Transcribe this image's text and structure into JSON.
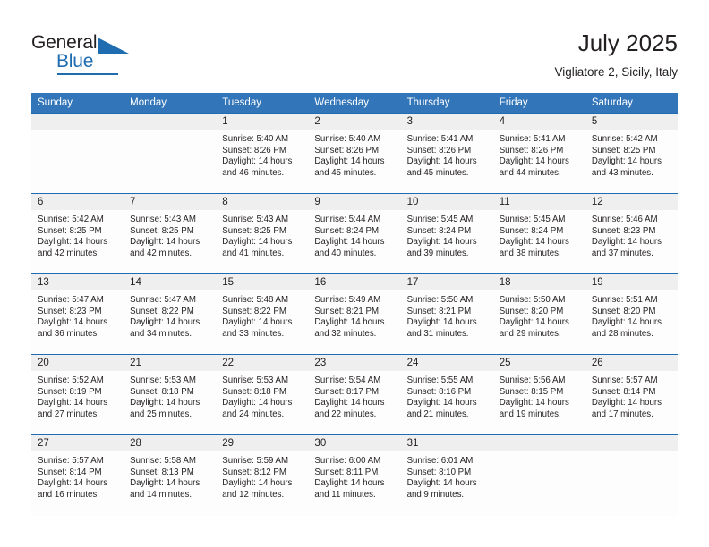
{
  "brand": {
    "name_part1": "General",
    "name_part2": "Blue",
    "logo_icon": "triangle-flag-icon",
    "accent_color": "#1f6cb0"
  },
  "header": {
    "title": "July 2025",
    "subtitle": "Vigliatore 2, Sicily, Italy"
  },
  "calendar": {
    "header_bg": "#3275b9",
    "row_rule_color": "#1f6cb0",
    "daynum_band_bg": "#efefef",
    "weekdays": [
      "Sunday",
      "Monday",
      "Tuesday",
      "Wednesday",
      "Thursday",
      "Friday",
      "Saturday"
    ],
    "weeks": [
      [
        {
          "day": "",
          "sunrise": "",
          "sunset": "",
          "daylight1": "",
          "daylight2": "",
          "empty": true
        },
        {
          "day": "",
          "sunrise": "",
          "sunset": "",
          "daylight1": "",
          "daylight2": "",
          "empty": true
        },
        {
          "day": "1",
          "sunrise": "Sunrise: 5:40 AM",
          "sunset": "Sunset: 8:26 PM",
          "daylight1": "Daylight: 14 hours",
          "daylight2": "and 46 minutes."
        },
        {
          "day": "2",
          "sunrise": "Sunrise: 5:40 AM",
          "sunset": "Sunset: 8:26 PM",
          "daylight1": "Daylight: 14 hours",
          "daylight2": "and 45 minutes."
        },
        {
          "day": "3",
          "sunrise": "Sunrise: 5:41 AM",
          "sunset": "Sunset: 8:26 PM",
          "daylight1": "Daylight: 14 hours",
          "daylight2": "and 45 minutes."
        },
        {
          "day": "4",
          "sunrise": "Sunrise: 5:41 AM",
          "sunset": "Sunset: 8:26 PM",
          "daylight1": "Daylight: 14 hours",
          "daylight2": "and 44 minutes."
        },
        {
          "day": "5",
          "sunrise": "Sunrise: 5:42 AM",
          "sunset": "Sunset: 8:25 PM",
          "daylight1": "Daylight: 14 hours",
          "daylight2": "and 43 minutes."
        }
      ],
      [
        {
          "day": "6",
          "sunrise": "Sunrise: 5:42 AM",
          "sunset": "Sunset: 8:25 PM",
          "daylight1": "Daylight: 14 hours",
          "daylight2": "and 42 minutes."
        },
        {
          "day": "7",
          "sunrise": "Sunrise: 5:43 AM",
          "sunset": "Sunset: 8:25 PM",
          "daylight1": "Daylight: 14 hours",
          "daylight2": "and 42 minutes."
        },
        {
          "day": "8",
          "sunrise": "Sunrise: 5:43 AM",
          "sunset": "Sunset: 8:25 PM",
          "daylight1": "Daylight: 14 hours",
          "daylight2": "and 41 minutes."
        },
        {
          "day": "9",
          "sunrise": "Sunrise: 5:44 AM",
          "sunset": "Sunset: 8:24 PM",
          "daylight1": "Daylight: 14 hours",
          "daylight2": "and 40 minutes."
        },
        {
          "day": "10",
          "sunrise": "Sunrise: 5:45 AM",
          "sunset": "Sunset: 8:24 PM",
          "daylight1": "Daylight: 14 hours",
          "daylight2": "and 39 minutes."
        },
        {
          "day": "11",
          "sunrise": "Sunrise: 5:45 AM",
          "sunset": "Sunset: 8:24 PM",
          "daylight1": "Daylight: 14 hours",
          "daylight2": "and 38 minutes."
        },
        {
          "day": "12",
          "sunrise": "Sunrise: 5:46 AM",
          "sunset": "Sunset: 8:23 PM",
          "daylight1": "Daylight: 14 hours",
          "daylight2": "and 37 minutes."
        }
      ],
      [
        {
          "day": "13",
          "sunrise": "Sunrise: 5:47 AM",
          "sunset": "Sunset: 8:23 PM",
          "daylight1": "Daylight: 14 hours",
          "daylight2": "and 36 minutes."
        },
        {
          "day": "14",
          "sunrise": "Sunrise: 5:47 AM",
          "sunset": "Sunset: 8:22 PM",
          "daylight1": "Daylight: 14 hours",
          "daylight2": "and 34 minutes."
        },
        {
          "day": "15",
          "sunrise": "Sunrise: 5:48 AM",
          "sunset": "Sunset: 8:22 PM",
          "daylight1": "Daylight: 14 hours",
          "daylight2": "and 33 minutes."
        },
        {
          "day": "16",
          "sunrise": "Sunrise: 5:49 AM",
          "sunset": "Sunset: 8:21 PM",
          "daylight1": "Daylight: 14 hours",
          "daylight2": "and 32 minutes."
        },
        {
          "day": "17",
          "sunrise": "Sunrise: 5:50 AM",
          "sunset": "Sunset: 8:21 PM",
          "daylight1": "Daylight: 14 hours",
          "daylight2": "and 31 minutes."
        },
        {
          "day": "18",
          "sunrise": "Sunrise: 5:50 AM",
          "sunset": "Sunset: 8:20 PM",
          "daylight1": "Daylight: 14 hours",
          "daylight2": "and 29 minutes."
        },
        {
          "day": "19",
          "sunrise": "Sunrise: 5:51 AM",
          "sunset": "Sunset: 8:20 PM",
          "daylight1": "Daylight: 14 hours",
          "daylight2": "and 28 minutes."
        }
      ],
      [
        {
          "day": "20",
          "sunrise": "Sunrise: 5:52 AM",
          "sunset": "Sunset: 8:19 PM",
          "daylight1": "Daylight: 14 hours",
          "daylight2": "and 27 minutes."
        },
        {
          "day": "21",
          "sunrise": "Sunrise: 5:53 AM",
          "sunset": "Sunset: 8:18 PM",
          "daylight1": "Daylight: 14 hours",
          "daylight2": "and 25 minutes."
        },
        {
          "day": "22",
          "sunrise": "Sunrise: 5:53 AM",
          "sunset": "Sunset: 8:18 PM",
          "daylight1": "Daylight: 14 hours",
          "daylight2": "and 24 minutes."
        },
        {
          "day": "23",
          "sunrise": "Sunrise: 5:54 AM",
          "sunset": "Sunset: 8:17 PM",
          "daylight1": "Daylight: 14 hours",
          "daylight2": "and 22 minutes."
        },
        {
          "day": "24",
          "sunrise": "Sunrise: 5:55 AM",
          "sunset": "Sunset: 8:16 PM",
          "daylight1": "Daylight: 14 hours",
          "daylight2": "and 21 minutes."
        },
        {
          "day": "25",
          "sunrise": "Sunrise: 5:56 AM",
          "sunset": "Sunset: 8:15 PM",
          "daylight1": "Daylight: 14 hours",
          "daylight2": "and 19 minutes."
        },
        {
          "day": "26",
          "sunrise": "Sunrise: 5:57 AM",
          "sunset": "Sunset: 8:14 PM",
          "daylight1": "Daylight: 14 hours",
          "daylight2": "and 17 minutes."
        }
      ],
      [
        {
          "day": "27",
          "sunrise": "Sunrise: 5:57 AM",
          "sunset": "Sunset: 8:14 PM",
          "daylight1": "Daylight: 14 hours",
          "daylight2": "and 16 minutes."
        },
        {
          "day": "28",
          "sunrise": "Sunrise: 5:58 AM",
          "sunset": "Sunset: 8:13 PM",
          "daylight1": "Daylight: 14 hours",
          "daylight2": "and 14 minutes."
        },
        {
          "day": "29",
          "sunrise": "Sunrise: 5:59 AM",
          "sunset": "Sunset: 8:12 PM",
          "daylight1": "Daylight: 14 hours",
          "daylight2": "and 12 minutes."
        },
        {
          "day": "30",
          "sunrise": "Sunrise: 6:00 AM",
          "sunset": "Sunset: 8:11 PM",
          "daylight1": "Daylight: 14 hours",
          "daylight2": "and 11 minutes."
        },
        {
          "day": "31",
          "sunrise": "Sunrise: 6:01 AM",
          "sunset": "Sunset: 8:10 PM",
          "daylight1": "Daylight: 14 hours",
          "daylight2": "and 9 minutes."
        },
        {
          "day": "",
          "sunrise": "",
          "sunset": "",
          "daylight1": "",
          "daylight2": "",
          "empty": true
        },
        {
          "day": "",
          "sunrise": "",
          "sunset": "",
          "daylight1": "",
          "daylight2": "",
          "empty": true
        }
      ]
    ]
  }
}
